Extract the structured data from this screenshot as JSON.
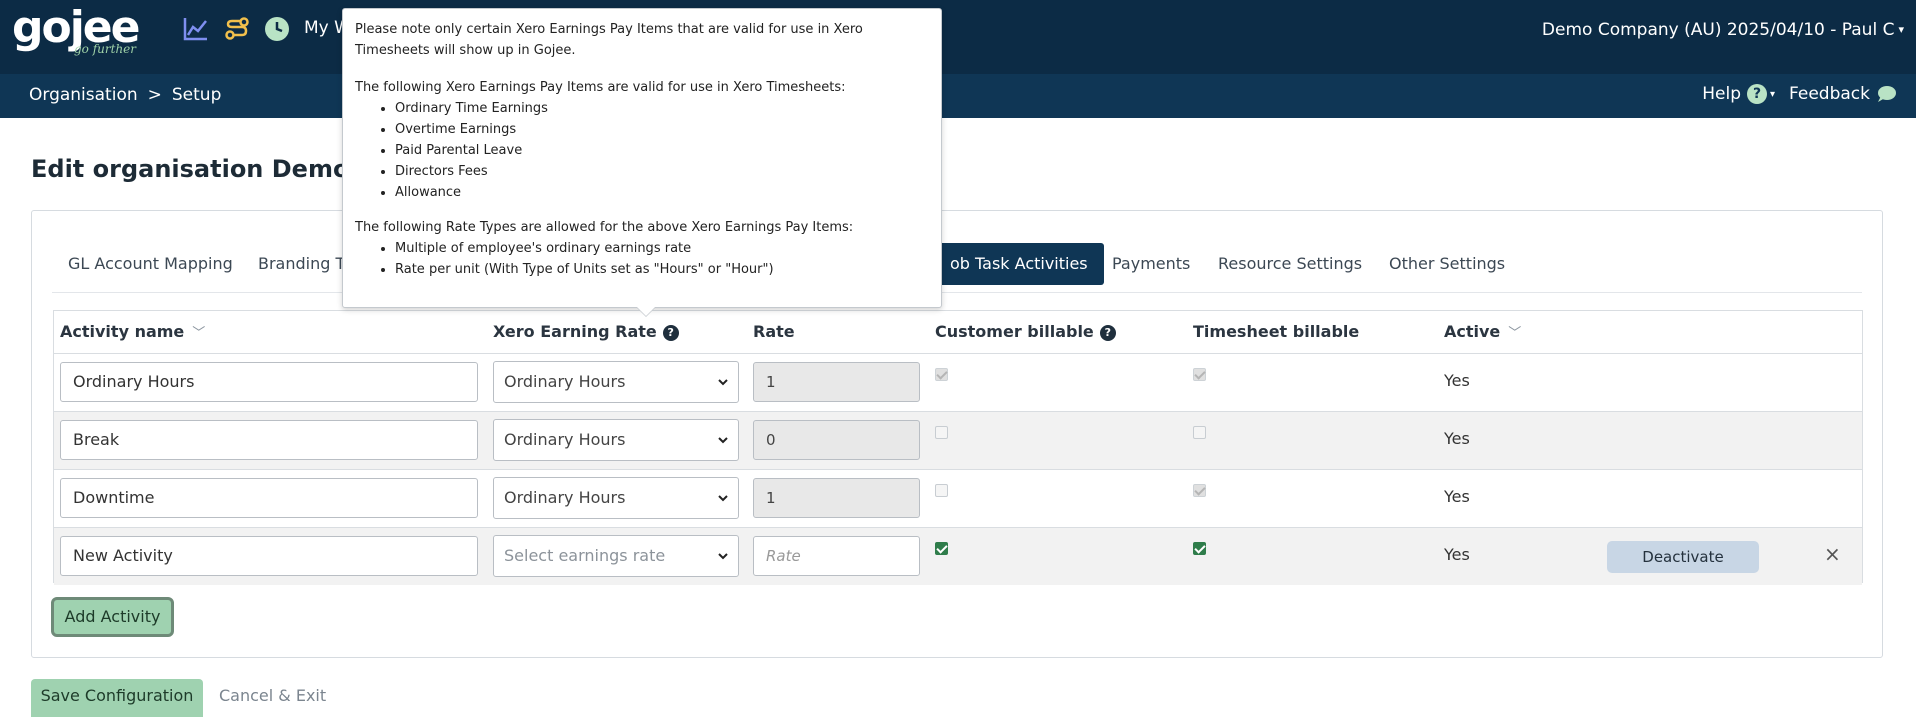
{
  "app": {
    "logo_text": "gojee",
    "logo_tagline": "go further",
    "nav_partial": "My W",
    "company": "Demo Company (AU) 2025/04/10 - Paul C"
  },
  "subnav": {
    "breadcrumb": [
      "Organisation",
      "Setup"
    ],
    "breadcrumb_sep": ">",
    "help_label": "Help",
    "feedback_label": "Feedback"
  },
  "page": {
    "title": "Edit organisation Demo Co"
  },
  "tabs": [
    {
      "label": "GL Account Mapping",
      "active": false
    },
    {
      "label": "Branding T",
      "active": false
    },
    {
      "label": "ob Task Activities",
      "active": true
    },
    {
      "label": "Payments",
      "active": false
    },
    {
      "label": "Resource Settings",
      "active": false
    },
    {
      "label": "Other Settings",
      "active": false
    }
  ],
  "table": {
    "headers": {
      "activity_name": "Activity name",
      "xero_rate": "Xero Earning Rate",
      "rate": "Rate",
      "customer_billable": "Customer billable",
      "timesheet_billable": "Timesheet billable",
      "active": "Active"
    },
    "rows": [
      {
        "name": "Ordinary Hours",
        "earning_rate": "Ordinary Hours",
        "rate": "1",
        "customer_billable": true,
        "timesheet_billable": true,
        "active": "Yes"
      },
      {
        "name": "Break",
        "earning_rate": "Ordinary Hours",
        "rate": "0",
        "customer_billable": false,
        "timesheet_billable": false,
        "active": "Yes"
      },
      {
        "name": "Downtime",
        "earning_rate": "Ordinary Hours",
        "rate": "1",
        "customer_billable": false,
        "timesheet_billable": true,
        "active": "Yes"
      },
      {
        "name": "New Activity",
        "earning_rate_placeholder": "Select earnings rate",
        "rate_placeholder": "Rate",
        "customer_billable": true,
        "timesheet_billable": true,
        "active": "Yes",
        "deactivate_label": "Deactivate",
        "close_symbol": "×"
      }
    ]
  },
  "buttons": {
    "add_activity": "Add Activity",
    "save_configuration": "Save Configuration",
    "cancel_exit": "Cancel & Exit"
  },
  "tooltip": {
    "intro": "Please note only certain Xero Earnings Pay Items that are valid for use in Xero Timesheets will show up in Gojee.",
    "pay_items_heading": "The following Xero Earnings Pay Items are valid for use in Xero Timesheets:",
    "pay_items": [
      "Ordinary Time Earnings",
      "Overtime Earnings",
      "Paid Parental Leave",
      "Directors Fees",
      "Allowance"
    ],
    "rate_types_heading": "The following Rate Types are allowed for the above Xero Earnings Pay Items:",
    "rate_types": [
      "Multiple of employee's ordinary earnings rate",
      "Rate per unit (With Type of Units set as \"Hours\" or \"Hour\")"
    ]
  },
  "colors": {
    "topbar": "#0c2b45",
    "subbar": "#0f3655",
    "active_tab": "#0f3655",
    "accent_green": "#9fd2b0",
    "help_badge": "#b9e3c5"
  },
  "icons": [
    "chart-line-icon",
    "route-icon",
    "clock-icon",
    "help-icon",
    "caret-down-icon",
    "chat-icon",
    "chevron-down-icon",
    "question-icon",
    "close-icon"
  ]
}
